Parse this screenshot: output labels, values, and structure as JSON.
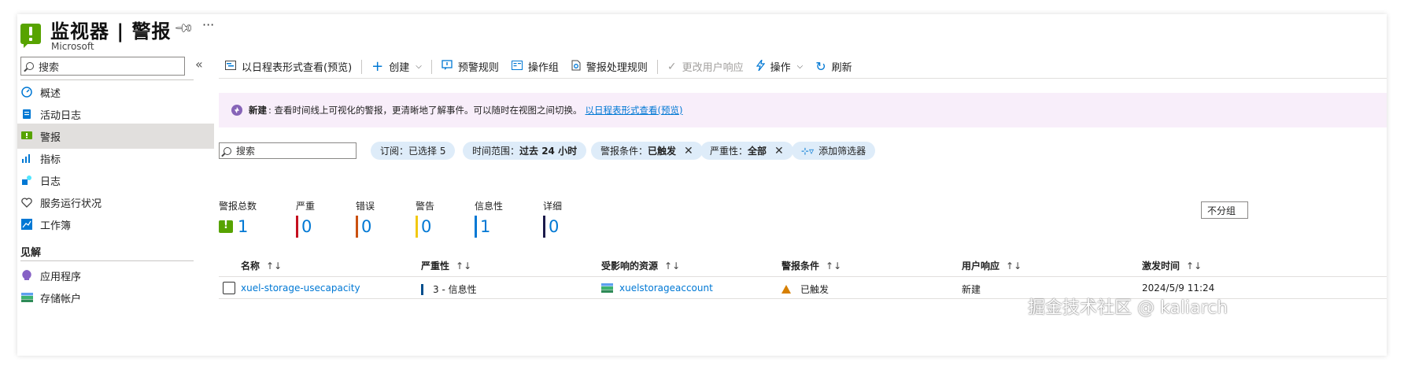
{
  "header": {
    "title": "监视器 | 警报",
    "subtitle": "Microsoft",
    "pin_icon": "pin-icon",
    "more_label": "···"
  },
  "sidebar": {
    "search_placeholder": "搜索",
    "collapse_label": "«",
    "items": [
      {
        "label": "概述",
        "icon": "overview-icon",
        "active": false
      },
      {
        "label": "活动日志",
        "icon": "activity-log-icon",
        "active": false
      },
      {
        "label": "警报",
        "icon": "alert-icon",
        "active": true
      },
      {
        "label": "指标",
        "icon": "metrics-icon",
        "active": false
      },
      {
        "label": "日志",
        "icon": "logs-icon",
        "active": false
      },
      {
        "label": "服务运行状况",
        "icon": "heart-icon",
        "active": false
      },
      {
        "label": "工作簿",
        "icon": "workbook-icon",
        "active": false
      }
    ],
    "section_title": "见解",
    "section_items": [
      {
        "label": "应用程序",
        "icon": "app-insights-icon"
      },
      {
        "label": "存储帐户",
        "icon": "storage-icon"
      }
    ]
  },
  "toolbar": {
    "timeline_view": "以日程表形式查看(预览)",
    "create": "创建",
    "alert_rules": "预警规则",
    "action_groups": "操作组",
    "processing_rules": "警报处理规则",
    "change_response": "更改用户响应",
    "actions": "操作",
    "refresh": "刷新"
  },
  "banner": {
    "bold": "新建",
    "text": ": 查看时间线上可视化的警报，更清晰地了解事件。可以随时在视图之间切换。",
    "link": "以日程表形式查看(预览)"
  },
  "filters": {
    "search_placeholder": "搜索",
    "subscription_key": "订阅：",
    "subscription_val": "已选择 5",
    "time_key": "时间范围：",
    "time_val": "过去 24 小时",
    "condition_key": "警报条件：",
    "condition_val": "已触发",
    "severity_key": "严重性：",
    "severity_val": "全部",
    "add_filter": "添加筛选器"
  },
  "summary": [
    {
      "label": "警报总数",
      "value": "1",
      "color": "#57a300"
    },
    {
      "label": "严重",
      "value": "0",
      "color": "#c50f1f"
    },
    {
      "label": "错误",
      "value": "0",
      "color": "#ca5010"
    },
    {
      "label": "警告",
      "value": "0",
      "color": "#f2c811"
    },
    {
      "label": "信息性",
      "value": "1",
      "color": "#0078d4"
    },
    {
      "label": "详细",
      "value": "0",
      "color": "#1b1a4a"
    }
  ],
  "group_select": "不分组",
  "table": {
    "columns": [
      "名称",
      "严重性",
      "受影响的资源",
      "警报条件",
      "用户响应",
      "激发时间"
    ],
    "sort_glyph": "↑↓",
    "rows": [
      {
        "name": "xuel-storage-usecapacity",
        "severity": "3 - 信息性",
        "resource": "xuelstorageaccount",
        "condition": "已触发",
        "response": "新建",
        "fired": "2024/5/9 11:24"
      }
    ]
  },
  "watermark": "掘金技术社区 @ kaliarch"
}
